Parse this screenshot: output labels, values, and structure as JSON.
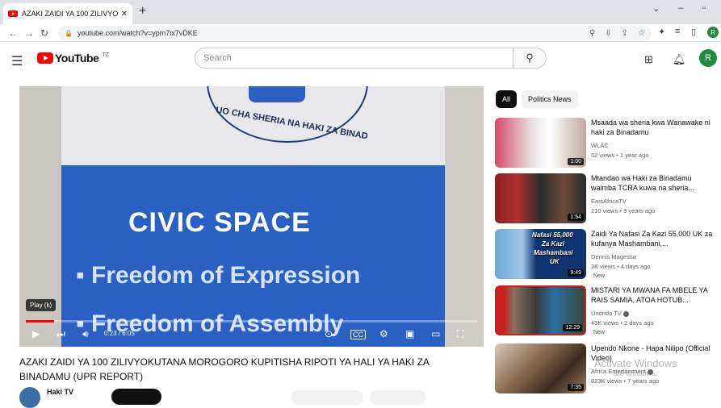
{
  "browser": {
    "tab_title": "AZAKI ZAIDI YA 100 ZILIVYOKUTA",
    "tab_close": "✕",
    "new_tab": "+",
    "url": "youtube.com/watch?v=ypm7ix7vDKE",
    "profile_initial": "R",
    "window_controls": [
      "⌄",
      "–",
      "▫"
    ]
  },
  "youtube": {
    "logo_text": "YouTube",
    "country_code": "TZ",
    "search_placeholder": "Search",
    "avatar_initial": "R"
  },
  "video": {
    "title": "AZAKI ZAIDI YA 100 ZILIVYOKUTANA MOROGORO KUPITISHA RIPOTI YA HALI YA HAKI ZA BINADAMU (UPR REPORT)",
    "time": "0:23 / 6:05",
    "tooltip": "Play (k)",
    "progress_percent": 6.3,
    "channel_name": "Haki TV",
    "frame_text": {
      "seal": "UO CHA SHERIA NA HAKI ZA BINAD",
      "heading": "CIVIC SPACE",
      "bullet1": "▪ Freedom of Expression",
      "bullet2": "▪ Freedom of Assembly"
    }
  },
  "filters": {
    "all": "All",
    "politics": "Politics News"
  },
  "recommendations": [
    {
      "title": "Msaada wa sheria kwa Wanawake ni haki za Binadamu",
      "channel": "WLAC",
      "meta": "52 views • 1 year ago",
      "duration": "1:00",
      "badge": ""
    },
    {
      "title": "Mtandao wa Haki za Binadamu waimba TCRA kuwa na sheria...",
      "channel": "EastAfricaTV",
      "meta": "210 views • 3 years ago",
      "duration": "1:54",
      "badge": ""
    },
    {
      "title": "Zaidi Ya Nafasi Za Kazi 55,000 UK za kufanya Mashambani,...",
      "channel": "Dennis Magessa",
      "meta": "2K views • 4 days ago",
      "duration": "9:49",
      "badge": "New",
      "thumb_text": [
        "Nafasi 55,000",
        "Za Kazi",
        "Mashambani",
        "UK"
      ]
    },
    {
      "title": "MISTARI YA MWANA FA MBELE YA RAIS SAMIA, ATOA HOTUB...",
      "channel": "Unondo TV",
      "meta": "45K views • 2 days ago",
      "duration": "12:29",
      "badge": "New"
    },
    {
      "title": "Upendo Nkone - Hapa Nilipo (Official Video)",
      "channel": "Africa Entertainment",
      "meta": "823K views • 7 years ago",
      "duration": "7:35",
      "badge": ""
    }
  ],
  "watermark": {
    "line1": "Activate Windows",
    "line2": "ate Windows."
  },
  "colors": {
    "youtube_red": "#ff0000",
    "banner_blue": "#2a5fc4",
    "profile_green": "#1e8e3e"
  }
}
